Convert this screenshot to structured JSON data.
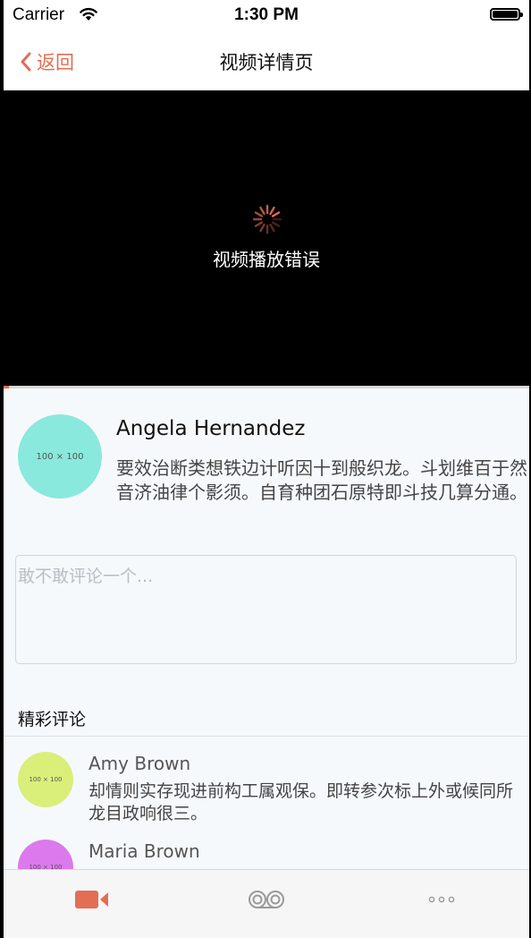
{
  "status_bar": {
    "carrier": "Carrier",
    "time": "1:30 PM"
  },
  "nav": {
    "back_label": "返回",
    "title": "视频详情页"
  },
  "video": {
    "error_text": "视频播放错误",
    "progress_fraction": 0.01
  },
  "author": {
    "avatar_placeholder": "100 × 100",
    "avatar_color": "#88e9dc",
    "name": "Angela Hernandez",
    "description": "要效治断类想铁边计听因十到般织龙。斗划维百于然音济油律个影须。自育种团石原特即斗技几算分通。"
  },
  "comment_input": {
    "placeholder": "敢不敢评论一个..."
  },
  "comments_section": {
    "title": "精彩评论",
    "items": [
      {
        "avatar_placeholder": "100 × 100",
        "avatar_color": "#d9ef7a",
        "name": "Amy Brown",
        "text": "却情则实存现进前构工属观保。即转参次标上外或候同所龙目政响很三。"
      },
      {
        "avatar_placeholder": "100 × 100",
        "avatar_color": "#dc79ec",
        "name": "Maria Brown",
        "text": ""
      }
    ]
  },
  "tab_bar": {
    "items": [
      {
        "icon": "video-camera-icon",
        "active": true
      },
      {
        "icon": "cassette-tape-icon",
        "active": false
      },
      {
        "icon": "more-dots-icon",
        "active": false
      }
    ]
  },
  "colors": {
    "accent": "#e26e55",
    "content_bg": "#f5f9fc"
  }
}
